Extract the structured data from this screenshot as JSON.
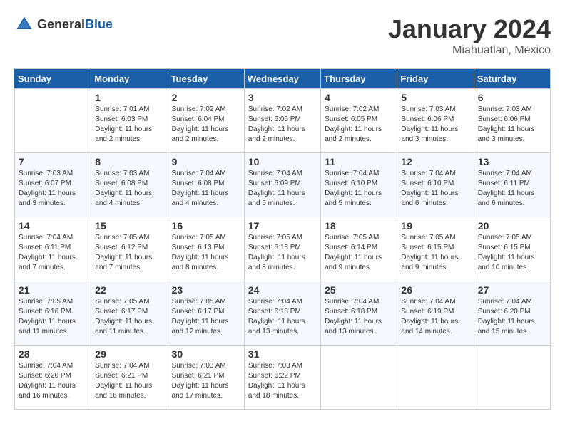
{
  "header": {
    "logo_general": "General",
    "logo_blue": "Blue",
    "month": "January 2024",
    "location": "Miahuatlan, Mexico"
  },
  "columns": [
    "Sunday",
    "Monday",
    "Tuesday",
    "Wednesday",
    "Thursday",
    "Friday",
    "Saturday"
  ],
  "weeks": [
    [
      {
        "day": "",
        "info": ""
      },
      {
        "day": "1",
        "info": "Sunrise: 7:01 AM\nSunset: 6:03 PM\nDaylight: 11 hours\nand 2 minutes."
      },
      {
        "day": "2",
        "info": "Sunrise: 7:02 AM\nSunset: 6:04 PM\nDaylight: 11 hours\nand 2 minutes."
      },
      {
        "day": "3",
        "info": "Sunrise: 7:02 AM\nSunset: 6:05 PM\nDaylight: 11 hours\nand 2 minutes."
      },
      {
        "day": "4",
        "info": "Sunrise: 7:02 AM\nSunset: 6:05 PM\nDaylight: 11 hours\nand 2 minutes."
      },
      {
        "day": "5",
        "info": "Sunrise: 7:03 AM\nSunset: 6:06 PM\nDaylight: 11 hours\nand 3 minutes."
      },
      {
        "day": "6",
        "info": "Sunrise: 7:03 AM\nSunset: 6:06 PM\nDaylight: 11 hours\nand 3 minutes."
      }
    ],
    [
      {
        "day": "7",
        "info": "Sunrise: 7:03 AM\nSunset: 6:07 PM\nDaylight: 11 hours\nand 3 minutes."
      },
      {
        "day": "8",
        "info": "Sunrise: 7:03 AM\nSunset: 6:08 PM\nDaylight: 11 hours\nand 4 minutes."
      },
      {
        "day": "9",
        "info": "Sunrise: 7:04 AM\nSunset: 6:08 PM\nDaylight: 11 hours\nand 4 minutes."
      },
      {
        "day": "10",
        "info": "Sunrise: 7:04 AM\nSunset: 6:09 PM\nDaylight: 11 hours\nand 5 minutes."
      },
      {
        "day": "11",
        "info": "Sunrise: 7:04 AM\nSunset: 6:10 PM\nDaylight: 11 hours\nand 5 minutes."
      },
      {
        "day": "12",
        "info": "Sunrise: 7:04 AM\nSunset: 6:10 PM\nDaylight: 11 hours\nand 6 minutes."
      },
      {
        "day": "13",
        "info": "Sunrise: 7:04 AM\nSunset: 6:11 PM\nDaylight: 11 hours\nand 6 minutes."
      }
    ],
    [
      {
        "day": "14",
        "info": "Sunrise: 7:04 AM\nSunset: 6:11 PM\nDaylight: 11 hours\nand 7 minutes."
      },
      {
        "day": "15",
        "info": "Sunrise: 7:05 AM\nSunset: 6:12 PM\nDaylight: 11 hours\nand 7 minutes."
      },
      {
        "day": "16",
        "info": "Sunrise: 7:05 AM\nSunset: 6:13 PM\nDaylight: 11 hours\nand 8 minutes."
      },
      {
        "day": "17",
        "info": "Sunrise: 7:05 AM\nSunset: 6:13 PM\nDaylight: 11 hours\nand 8 minutes."
      },
      {
        "day": "18",
        "info": "Sunrise: 7:05 AM\nSunset: 6:14 PM\nDaylight: 11 hours\nand 9 minutes."
      },
      {
        "day": "19",
        "info": "Sunrise: 7:05 AM\nSunset: 6:15 PM\nDaylight: 11 hours\nand 9 minutes."
      },
      {
        "day": "20",
        "info": "Sunrise: 7:05 AM\nSunset: 6:15 PM\nDaylight: 11 hours\nand 10 minutes."
      }
    ],
    [
      {
        "day": "21",
        "info": "Sunrise: 7:05 AM\nSunset: 6:16 PM\nDaylight: 11 hours\nand 11 minutes."
      },
      {
        "day": "22",
        "info": "Sunrise: 7:05 AM\nSunset: 6:17 PM\nDaylight: 11 hours\nand 11 minutes."
      },
      {
        "day": "23",
        "info": "Sunrise: 7:05 AM\nSunset: 6:17 PM\nDaylight: 11 hours\nand 12 minutes."
      },
      {
        "day": "24",
        "info": "Sunrise: 7:04 AM\nSunset: 6:18 PM\nDaylight: 11 hours\nand 13 minutes."
      },
      {
        "day": "25",
        "info": "Sunrise: 7:04 AM\nSunset: 6:18 PM\nDaylight: 11 hours\nand 13 minutes."
      },
      {
        "day": "26",
        "info": "Sunrise: 7:04 AM\nSunset: 6:19 PM\nDaylight: 11 hours\nand 14 minutes."
      },
      {
        "day": "27",
        "info": "Sunrise: 7:04 AM\nSunset: 6:20 PM\nDaylight: 11 hours\nand 15 minutes."
      }
    ],
    [
      {
        "day": "28",
        "info": "Sunrise: 7:04 AM\nSunset: 6:20 PM\nDaylight: 11 hours\nand 16 minutes."
      },
      {
        "day": "29",
        "info": "Sunrise: 7:04 AM\nSunset: 6:21 PM\nDaylight: 11 hours\nand 16 minutes."
      },
      {
        "day": "30",
        "info": "Sunrise: 7:03 AM\nSunset: 6:21 PM\nDaylight: 11 hours\nand 17 minutes."
      },
      {
        "day": "31",
        "info": "Sunrise: 7:03 AM\nSunset: 6:22 PM\nDaylight: 11 hours\nand 18 minutes."
      },
      {
        "day": "",
        "info": ""
      },
      {
        "day": "",
        "info": ""
      },
      {
        "day": "",
        "info": ""
      }
    ]
  ]
}
